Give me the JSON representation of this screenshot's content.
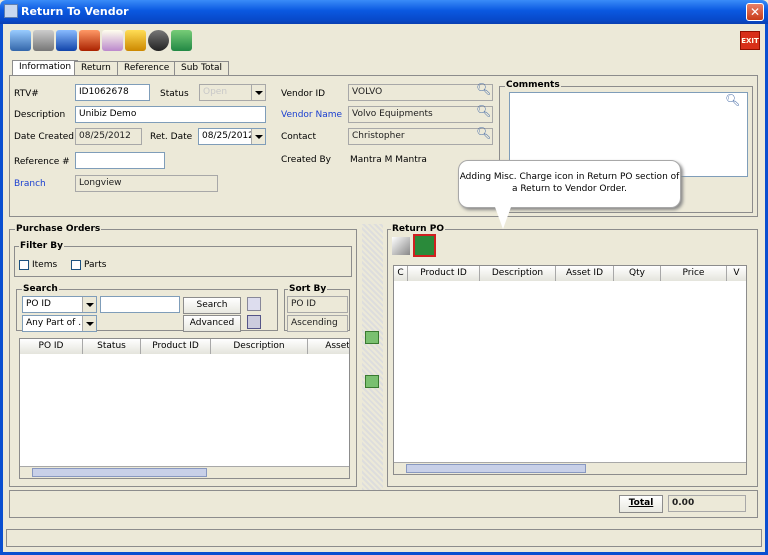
{
  "window": {
    "title": "Return To Vendor"
  },
  "toolbar": {
    "exit_label": "EXIT"
  },
  "tabs": [
    "Information",
    "Return",
    "Reference",
    "Sub Total"
  ],
  "info": {
    "rtv_label": "RTV#",
    "rtv_value": "ID1062678",
    "status_label": "Status",
    "status_value": "Open",
    "description_label": "Description",
    "description_value": "Unibiz Demo",
    "date_created_label": "Date Created",
    "date_created_value": "08/25/2012",
    "ret_date_label": "Ret. Date",
    "ret_date_value": "08/25/2012",
    "reference_label": "Reference #",
    "reference_value": "",
    "branch_label": "Branch",
    "branch_value": "Longview",
    "vendor_id_label": "Vendor ID",
    "vendor_id_value": "VOLVO",
    "vendor_name_label": "Vendor Name",
    "vendor_name_value": "Volvo Equipments",
    "contact_label": "Contact",
    "contact_value": "Christopher",
    "created_by_label": "Created By",
    "created_by_value": "Mantra M Mantra",
    "comments_label": "Comments"
  },
  "callout": {
    "text": "Adding Misc. Charge icon in Return PO section of a Return to Vendor Order."
  },
  "purchase_orders": {
    "title": "Purchase Orders",
    "filter_by": "Filter By",
    "items": "Items",
    "parts": "Parts",
    "search_title": "Search",
    "search_field": "PO ID",
    "search_mode": "Any Part of ...",
    "search_btn": "Search",
    "advanced_btn": "Advanced",
    "sort_title": "Sort By",
    "sort_field": "PO ID",
    "sort_order": "Ascending",
    "columns": [
      "PO ID",
      "Status",
      "Product ID",
      "Description",
      "Asset"
    ]
  },
  "return_po": {
    "title": "Return PO",
    "columns": [
      "C",
      "Product ID",
      "Description",
      "Asset ID",
      "Qty",
      "Price",
      "V"
    ]
  },
  "footer": {
    "total_label": "Total",
    "total_value": "0.00"
  },
  "colors": {
    "title_bar": "#0a58e0",
    "link_label": "#1a3fd0",
    "highlight": "#d02020"
  }
}
